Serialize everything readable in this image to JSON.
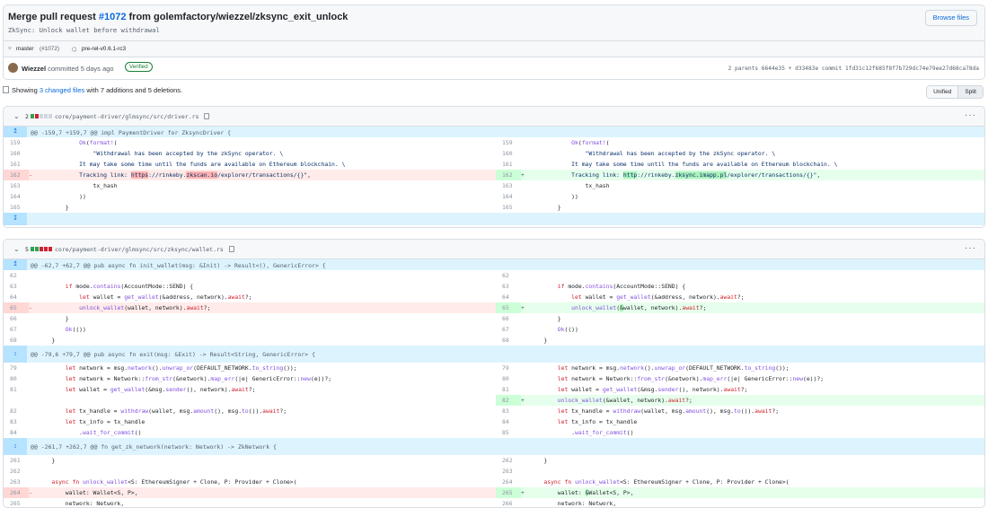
{
  "commit": {
    "title_prefix": "Merge pull request ",
    "pr_link": "#1072",
    "title_suffix": " from golemfactory/wiezzel/zksync_exit_unlock",
    "description": "ZkSync: Unlock wallet before withdrawal",
    "browse_button": "Browse files",
    "branch": "master",
    "branch_pr": "(#1072)",
    "tag": "pre-rel-v0.6.1-rc3",
    "author": "Wiezzel",
    "committed_text": "committed 5 days ago",
    "verified": "Verified",
    "parents_text": "2 parents 6644e35 + d33483e    commit 1fd31c12f685f8f7b729dc74e79ee27d68ca78da"
  },
  "summary": {
    "showing": "Showing ",
    "changed_files": "3 changed files",
    "rest": " with 7 additions and 5 deletions.",
    "unified": "Unified",
    "split": "Split"
  },
  "files": [
    {
      "count": "2",
      "path": "core/payment-driver/glmsync/src/driver.rs",
      "hunk": "@@ -159,7 +159,7 @@ impl PaymentDriver for ZksyncDriver {"
    },
    {
      "count": "5",
      "path": "core/payment-driver/glmsync/src/zksync/wallet.rs",
      "hunk1": "@@ -62,7 +62,7 @@ pub async fn init_wallet(msg: &Init) -> Result<(), GenericError> {",
      "hunk2": "@@ -79,6 +79,7 @@ pub async fn exit(msg: &Exit) -> Result<String, GenericError> {",
      "hunk3": "@@ -261,7 +262,7 @@ fn get_zk_network(network: Network) -> ZkNetwork {"
    }
  ],
  "colors": {
    "accent": "#0969da",
    "add": "#e6ffec",
    "del": "#ffebe9",
    "hunk": "#ddf4ff"
  },
  "icons": [
    "branch-icon",
    "tag-icon",
    "file-icon",
    "copy-icon",
    "chevron-down-icon",
    "kebab-icon",
    "expand-up-icon",
    "expand-down-icon"
  ]
}
